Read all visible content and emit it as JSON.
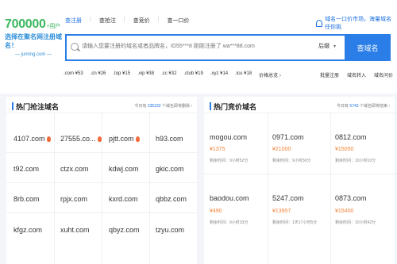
{
  "logo": {
    "big": "700000",
    "small": "+用户",
    "line": "选择在聚名网注册域名！",
    "url": "— juming.com —"
  },
  "nav": [
    "查注册",
    "查抢注",
    "查竞价",
    "查一口价"
  ],
  "topright": "域名一口价市场，海量域名任你挑",
  "search": {
    "placeholder": "请输入您要注册的域名或者品牌名，ID55***8 刚刚注册了 wa***88.com",
    "suffix": "后缀",
    "button": "查域名"
  },
  "tlds": [
    ".com ¥53",
    ".cn ¥26",
    ".top ¥15",
    ".vip ¥38",
    ".cc ¥32",
    ".club ¥19",
    ".xyz ¥14",
    ".icu ¥18",
    "价格总览 ›"
  ],
  "tools": [
    "批量注册",
    "域名转入",
    "域名问价"
  ],
  "left": {
    "title": "热门抢注域名",
    "stat_prefix": "今日有",
    "stat_count": "235232",
    "stat_suffix": "个域名即将删除 ›",
    "rows": [
      [
        "4107.com",
        "27555.co...",
        "pjtt.com",
        "h93.com"
      ],
      [
        "t92.com",
        "ctzx.com",
        "kdwj.com",
        "gkic.com"
      ],
      [
        "8rb.com",
        "rpjx.com",
        "kxrd.com",
        "qbbz.com"
      ],
      [
        "kfgz.com",
        "xuht.com",
        "qbyz.com",
        "tzyu.com"
      ]
    ],
    "hot": [
      [
        true,
        true,
        true,
        false
      ],
      [
        false,
        false,
        false,
        false
      ],
      [
        false,
        false,
        false,
        false
      ],
      [
        false,
        false,
        false,
        false
      ]
    ]
  },
  "right": {
    "title": "热门竞价域名",
    "stat_prefix": "今日有",
    "stat_count": "5743",
    "stat_suffix": "个域名即将结束 ›",
    "items": [
      [
        {
          "name": "mogou.com",
          "price": "¥1375",
          "remain": "剩余时间：9小时52分"
        },
        {
          "name": "0971.com",
          "price": "¥21000",
          "remain": "剩余时间：9小时56分"
        },
        {
          "name": "0812.com",
          "price": "¥15050",
          "remain": "剩余时间：10小时10分"
        }
      ],
      [
        {
          "name": "baodou.com",
          "price": "¥490",
          "remain": "剩余时间：9小时33分"
        },
        {
          "name": "5247.com",
          "price": "¥13957",
          "remain": "剩余时间：1天17小时5分"
        },
        {
          "name": "0873.com",
          "price": "¥15400",
          "remain": "剩余时间：10小时42分"
        }
      ]
    ]
  }
}
